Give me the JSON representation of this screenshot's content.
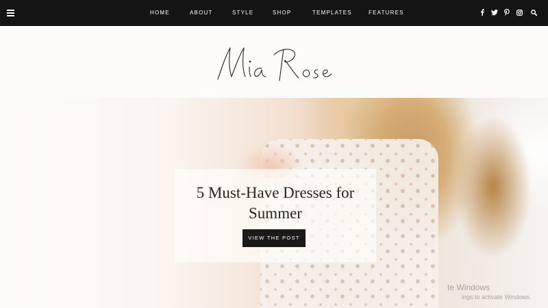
{
  "nav": {
    "items": [
      "HOME",
      "ABOUT",
      "STYLE",
      "SHOP",
      "TEMPLATES",
      "FEATURES"
    ],
    "social_icons": [
      "facebook-icon",
      "twitter-icon",
      "pinterest-icon",
      "instagram-icon"
    ],
    "search_icon": "search-icon",
    "menu_icon": "hamburger-menu-icon"
  },
  "site": {
    "logo_text": "Mia Rose"
  },
  "hero": {
    "title": "5 Must-Have Dresses for Summer",
    "button_label": "VIEW THE POST"
  },
  "watermark": {
    "line1": "te Windows",
    "line2": "ings to activate Windows."
  },
  "colors": {
    "navbar": "#141414",
    "button": "#1b1a19",
    "text_dark": "#2a2320",
    "background": "#fdfbfa"
  }
}
